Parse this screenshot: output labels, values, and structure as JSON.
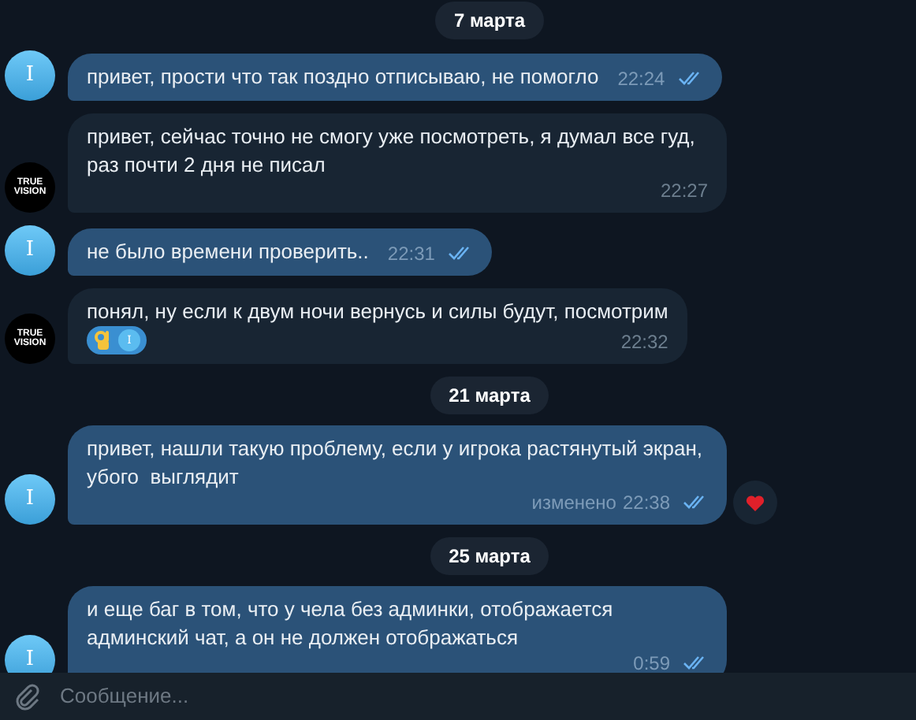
{
  "feed": [
    {
      "kind": "date",
      "text": "7 марта"
    },
    {
      "kind": "outgoing",
      "avatar": "I",
      "text": "привет, прости что так поздно отписываю, не помогло",
      "time": "22:24",
      "read": true
    },
    {
      "kind": "incoming",
      "avatar": "TRUE VISION",
      "text": "привет, сейчас точно не смогу уже посмотреть, я думал все гуд, раз почти 2 дня не писал",
      "time": "22:27"
    },
    {
      "kind": "outgoing",
      "avatar": "I",
      "text": "не было времени проверить..",
      "time": "22:31",
      "read": true
    },
    {
      "kind": "incoming",
      "avatar": "TRUE VISION",
      "text": "понял, ну если к двум ночи вернусь и силы будут, посмотрим",
      "time": "22:32",
      "reaction": {
        "kind": "ok",
        "by": "I"
      }
    },
    {
      "kind": "date",
      "text": "21 марта"
    },
    {
      "kind": "outgoing",
      "avatar": "I",
      "text": "привет, нашли такую проблему, если у игрока растянутый экран, убого  выглядит",
      "time": "22:38",
      "edited": "изменено",
      "read": true,
      "side_reaction": {
        "kind": "heart"
      }
    },
    {
      "kind": "date",
      "text": "25 марта"
    },
    {
      "kind": "outgoing",
      "avatar": "I",
      "text": "и еще баг в том, что у чела без админки, отображается админский чат, а он не должен отображаться",
      "time": "0:59",
      "read": true
    }
  ],
  "composer": {
    "placeholder": "Сообщение..."
  }
}
